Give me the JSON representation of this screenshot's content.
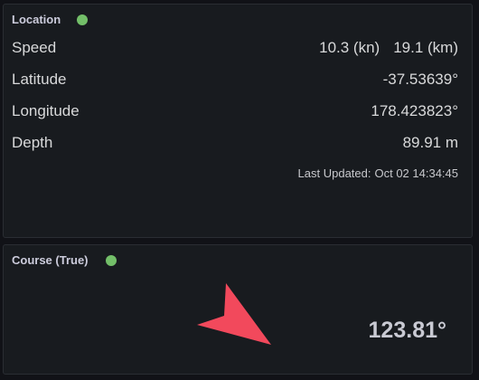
{
  "location_panel": {
    "title": "Location",
    "status_color": "#73bf69",
    "speed": {
      "label": "Speed",
      "value_kn": "10.3 (kn)",
      "value_km": "19.1 (km)"
    },
    "latitude": {
      "label": "Latitude",
      "value": "-37.53639°"
    },
    "longitude": {
      "label": "Longitude",
      "value": "178.423823°"
    },
    "depth": {
      "label": "Depth",
      "value": "89.91 m"
    },
    "last_updated": {
      "label": "Last Updated:",
      "value": "Oct 02 14:34:45"
    }
  },
  "course_panel": {
    "title": "Course (True)",
    "status_color": "#73bf69",
    "value": "123.81°",
    "arrow_color": "#f2495c",
    "arrow_icon": "direction-arrow-icon"
  }
}
